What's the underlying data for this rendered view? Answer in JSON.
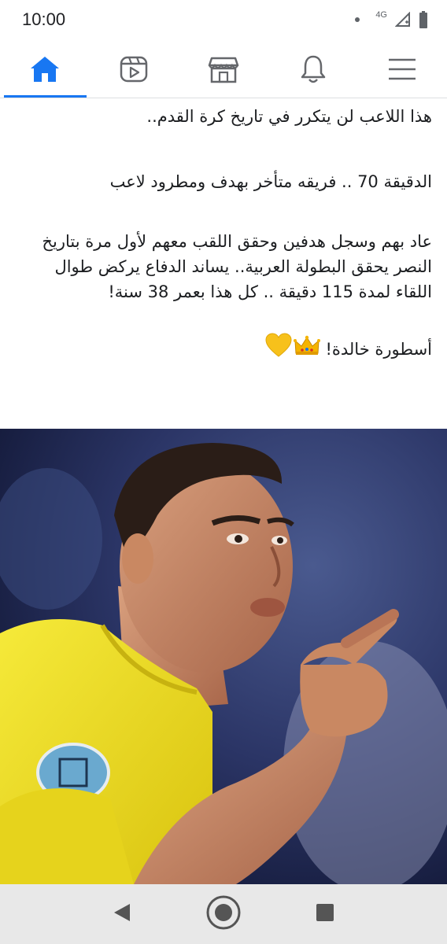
{
  "status_bar": {
    "time": "10:00",
    "network": "4G",
    "icons": [
      "notification-dot-icon",
      "signal-icon",
      "battery-icon"
    ]
  },
  "top_nav": {
    "items": [
      {
        "icon": "home-icon",
        "active": true
      },
      {
        "icon": "video-icon",
        "active": false
      },
      {
        "icon": "marketplace-icon",
        "active": false
      },
      {
        "icon": "bell-icon",
        "active": false
      },
      {
        "icon": "menu-icon",
        "active": false
      }
    ],
    "accent_color": "#1877f2"
  },
  "post": {
    "lines": {
      "p1": "هذا اللاعب لن يتكرر في تاريخ كرة القدم..",
      "p2": "الدقيقة 70 .. فريقه متأخر بهدف ومطرود لاعب",
      "p3": "عاد بهم وسجل هدفين وحقق اللقب معهم لأول مرة بتاريخ النصر يحقق البطولة العربية.. يساند الدفاع يركض طوال اللقاء لمدة 115 دقيقة .. كل هذا بعمر 38 سنة!",
      "p4": "أسطورة خالدة!"
    },
    "emojis": [
      "crown-emoji",
      "yellow-heart-emoji"
    ]
  },
  "photo": {
    "subject": "football-player-photo",
    "shirt_color": "#f2e21a"
  },
  "system_nav": {
    "buttons": [
      "back-icon",
      "home-circle-icon",
      "recents-icon"
    ]
  }
}
